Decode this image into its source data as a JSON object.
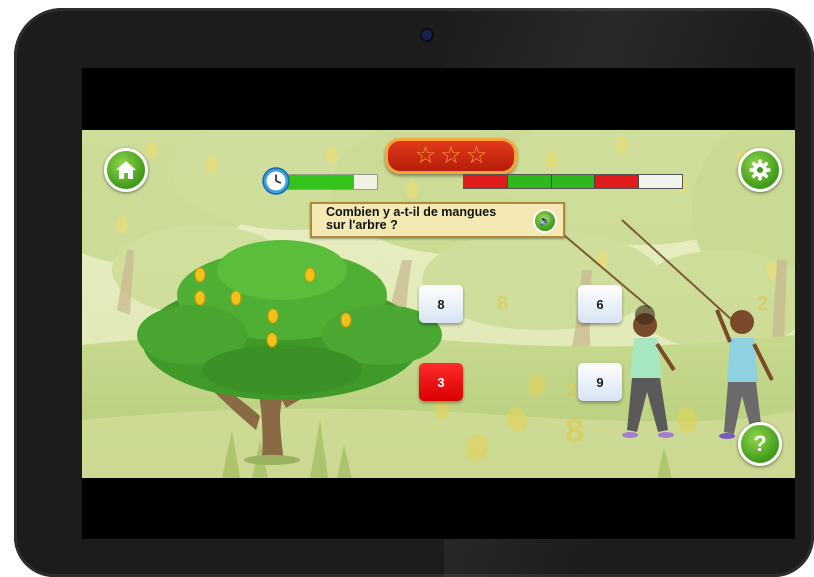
{
  "game": {
    "stars": {
      "filled": 0,
      "total": 3
    },
    "timer": {
      "remaining_fraction": 0.75
    },
    "progress": {
      "segments": [
        {
          "status": "wrong",
          "color": "#e01b1b"
        },
        {
          "status": "correct",
          "color": "#2fb81c"
        },
        {
          "status": "correct",
          "color": "#2fb81c"
        },
        {
          "status": "wrong",
          "color": "#e01b1b"
        },
        {
          "status": "pending",
          "color": "#f3f3ee"
        }
      ]
    },
    "question": {
      "line1": "Combien y a-t-il de mangues",
      "line2": "sur l'arbre ?"
    },
    "answers": [
      {
        "label": "8",
        "state": "idle"
      },
      {
        "label": "6",
        "state": "idle"
      },
      {
        "label": "3",
        "state": "wrong"
      },
      {
        "label": "9",
        "state": "idle"
      }
    ],
    "icons": {
      "home": "home-icon",
      "settings": "gear-icon",
      "help": "question-mark-icon",
      "sound": "speaker-icon",
      "clock": "clock-icon"
    },
    "help_label": "?",
    "colors": {
      "button_green": "#3f9a1a",
      "banner_red": "#d72a12",
      "wrong_red": "#ff0f0f",
      "question_bg": "#f4e9b4"
    }
  }
}
